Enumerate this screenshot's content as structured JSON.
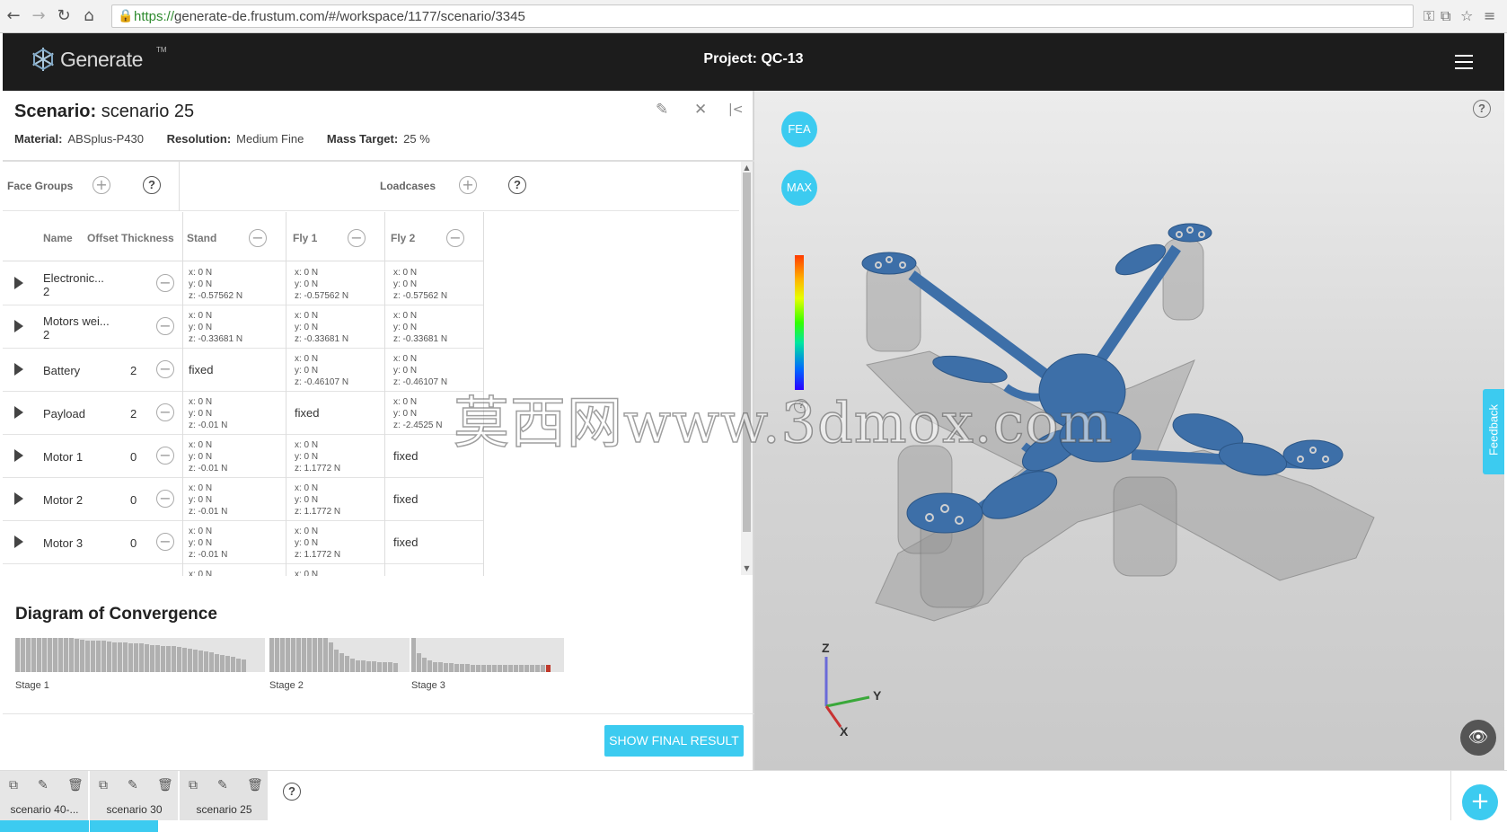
{
  "browser": {
    "url_protocol": "https://",
    "url_rest": "generate-de.frustum.com/#/workspace/1177/scenario/3345"
  },
  "app": {
    "logo_text": "Generate",
    "logo_tm": "TM",
    "project_title": "Project: QC-13"
  },
  "scenario": {
    "title_label": "Scenario:",
    "title_value": "scenario 25",
    "material_label": "Material:",
    "material_value": "ABSplus-P430",
    "resolution_label": "Resolution:",
    "resolution_value": "Medium Fine",
    "mass_label": "Mass Target:",
    "mass_value": "25 %"
  },
  "groups": {
    "face_groups_label": "Face Groups",
    "loadcases_label": "Loadcases"
  },
  "table": {
    "columns": {
      "name": "Name",
      "offset": "Offset Thickness",
      "loadcases": [
        "Stand",
        "Fly 1",
        "Fly 2"
      ]
    },
    "rows": [
      {
        "name": "Electronic...",
        "offset": "2",
        "cells": [
          [
            "x: 0 N",
            "y: 0 N",
            "z: -0.57562 N"
          ],
          [
            "x: 0 N",
            "y: 0 N",
            "z: -0.57562 N"
          ],
          [
            "x: 0 N",
            "y: 0 N",
            "z: -0.57562 N"
          ]
        ]
      },
      {
        "name": "Motors wei...",
        "offset": "2",
        "cells": [
          [
            "x: 0 N",
            "y: 0 N",
            "z: -0.33681 N"
          ],
          [
            "x: 0 N",
            "y: 0 N",
            "z: -0.33681 N"
          ],
          [
            "x: 0 N",
            "y: 0 N",
            "z: -0.33681 N"
          ]
        ]
      },
      {
        "name": "Battery",
        "offset": "2",
        "cells": [
          "fixed",
          [
            "x: 0 N",
            "y: 0 N",
            "z: -0.46107 N"
          ],
          [
            "x: 0 N",
            "y: 0 N",
            "z: -0.46107 N"
          ]
        ]
      },
      {
        "name": "Payload",
        "offset": "2",
        "cells": [
          [
            "x: 0 N",
            "y: 0 N",
            "z: -0.01 N"
          ],
          "fixed",
          [
            "x: 0 N",
            "y: 0 N",
            "z: -2.4525 N"
          ]
        ]
      },
      {
        "name": "Motor 1",
        "offset": "0",
        "cells": [
          [
            "x: 0 N",
            "y: 0 N",
            "z: -0.01 N"
          ],
          [
            "x: 0 N",
            "y: 0 N",
            "z: 1.1772 N"
          ],
          "fixed"
        ]
      },
      {
        "name": "Motor 2",
        "offset": "0",
        "cells": [
          [
            "x: 0 N",
            "y: 0 N",
            "z: -0.01 N"
          ],
          [
            "x: 0 N",
            "y: 0 N",
            "z: 1.1772 N"
          ],
          "fixed"
        ]
      },
      {
        "name": "Motor 3",
        "offset": "0",
        "cells": [
          [
            "x: 0 N",
            "y: 0 N",
            "z: -0.01 N"
          ],
          [
            "x: 0 N",
            "y: 0 N",
            "z: 1.1772 N"
          ],
          "fixed"
        ]
      },
      {
        "name": "",
        "offset": "",
        "cells": [
          [
            "x: 0 N"
          ],
          [
            "x: 0 N"
          ],
          []
        ]
      }
    ]
  },
  "convergence": {
    "title": "Diagram of Convergence",
    "stages": [
      {
        "label": "Stage 1",
        "values": [
          1,
          1,
          1,
          1,
          1,
          1,
          1,
          1,
          1,
          1,
          1,
          0.97,
          0.95,
          0.93,
          0.93,
          0.92,
          0.91,
          0.9,
          0.88,
          0.87,
          0.86,
          0.85,
          0.84,
          0.83,
          0.82,
          0.8,
          0.79,
          0.77,
          0.76,
          0.75,
          0.73,
          0.71,
          0.69,
          0.66,
          0.63,
          0.6,
          0.57,
          0.53,
          0.5,
          0.47,
          0.44,
          0.4,
          0.36
        ],
        "highlight_last": false
      },
      {
        "label": "Stage 2",
        "values": [
          1,
          1,
          1,
          1,
          1,
          1,
          1,
          1,
          1,
          1,
          1,
          0.88,
          0.66,
          0.56,
          0.48,
          0.4,
          0.35,
          0.33,
          0.32,
          0.31,
          0.3,
          0.29,
          0.28,
          0.27
        ],
        "highlight_last": false
      },
      {
        "label": "Stage 3",
        "values": [
          1,
          0.55,
          0.42,
          0.33,
          0.3,
          0.28,
          0.26,
          0.25,
          0.24,
          0.23,
          0.23,
          0.22,
          0.22,
          0.21,
          0.21,
          0.21,
          0.21,
          0.21,
          0.21,
          0.2,
          0.2,
          0.2,
          0.2,
          0.2,
          0.2,
          0.2
        ],
        "highlight_last": true
      }
    ]
  },
  "actions": {
    "show_final": "SHOW FINAL RESULT"
  },
  "viewport": {
    "fea_label": "FEA",
    "max_label": "MAX",
    "feedback_label": "Feedback",
    "axis_x": "X",
    "axis_y": "Y",
    "axis_z": "Z",
    "watermark": "莫西网www.3dmox.com"
  },
  "tabs": [
    {
      "label": "scenario 40-...",
      "active": false
    },
    {
      "label": "scenario 30",
      "active": false
    },
    {
      "label": "scenario 25",
      "active": true
    }
  ],
  "colors": {
    "accent": "#3ccbf0",
    "header_bg": "#1c1c1c",
    "model_blue": "#3d6fa8",
    "converge_last": "#c0392b"
  }
}
